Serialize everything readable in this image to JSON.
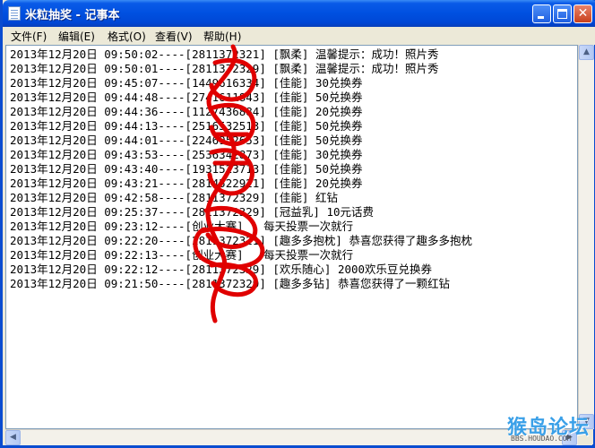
{
  "window": {
    "title": "米粒抽奖 - 记事本",
    "minimize_glyph": "",
    "maximize_glyph": "",
    "close_glyph": "✕"
  },
  "menu": [
    {
      "label": "文件(F)"
    },
    {
      "label": "编辑(E)"
    },
    {
      "label": "格式(O)"
    },
    {
      "label": "查看(V)"
    },
    {
      "label": "帮助(H)"
    }
  ],
  "lines": [
    "2013年12月20日 09:50:02----[2811372321] [飘柔] 温馨提示：成功！照片秀",
    "2013年12月20日 09:50:01----[2811372329] [飘柔] 温馨提示：成功！照片秀",
    "2013年12月20日 09:45:07----[1449616334] [佳能] 30兑换券",
    "2013年12月20日 09:44:48----[2741611843] [佳能] 50兑换券",
    "2013年12月20日 09:44:36----[1127436884] [佳能] 20兑换券",
    "2013年12月20日 09:44:13----[2516532513] [佳能] 50兑换券",
    "2013年12月20日 09:44:01----[2246952653] [佳能] 50兑换券",
    "2013年12月20日 09:43:53----[2536342873] [佳能] 30兑换券",
    "2013年12月20日 09:43:40----[1931523713] [佳能] 50兑换券",
    "2013年12月20日 09:43:21----[2814522921] [佳能] 20兑换券",
    "2013年12月20日 09:42:58----[2811372329] [佳能] 红钻",
    "2013年12月20日 09:25:37----[2811372329] [冠益乳] 10元话费",
    "2013年12月20日 09:23:12----[创业大赛]   每天投票一次就行",
    "2013年12月20日 09:22:20----[2811372321] [趣多多抱枕] 恭喜您获得了趣多多抱枕",
    "2013年12月20日 09:22:13----[创业大赛]   每天投票一次就行",
    "2013年12月20日 09:22:12----[2811372329] [欢乐随心] 2000欢乐豆兑换券",
    "2013年12月20日 09:21:50----[2811372329] [趣多多钻] 恭喜您获得了一颗红钻"
  ],
  "scrollbar": {
    "up_arrow": "▲",
    "down_arrow": "▼",
    "left_arrow": "◀",
    "right_arrow": "▶"
  },
  "watermark": {
    "main": "猴岛论坛",
    "sub": "BBS.HOUDAO.COM"
  },
  "colors": {
    "titlebar": "#0050e0",
    "scribble": "#e00000"
  }
}
